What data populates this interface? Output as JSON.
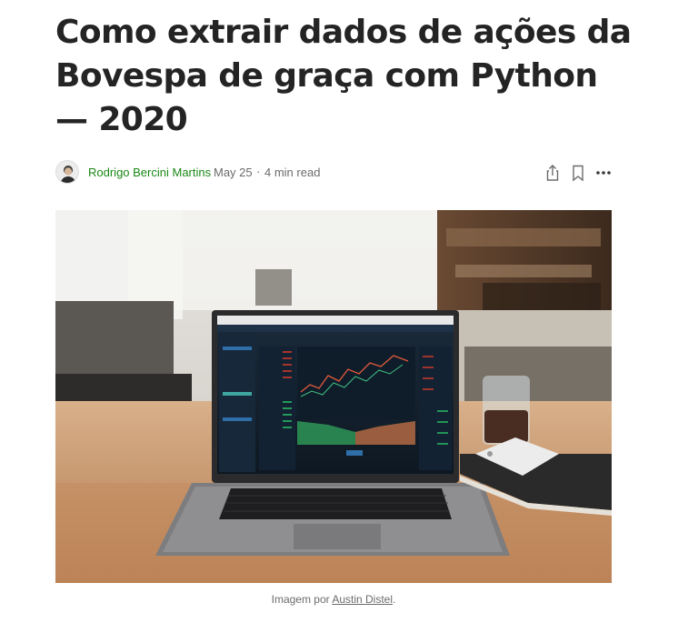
{
  "article": {
    "title": "Como extrair dados de ações da Bovespa de graça com Python — 2020"
  },
  "meta": {
    "author": "Rodrigo Bercini Martins",
    "date": "May 25",
    "separator": "·",
    "read_time": "4 min read"
  },
  "actions": {
    "icons": [
      "share-icon",
      "bookmark-icon",
      "more-icon"
    ]
  },
  "image": {
    "caption_prefix": "Imagem por ",
    "caption_link": "Austin Distel",
    "caption_suffix": "."
  },
  "colors": {
    "author_link": "#1a8917",
    "title_text": "#242424",
    "muted_text": "#6b6b6b"
  }
}
